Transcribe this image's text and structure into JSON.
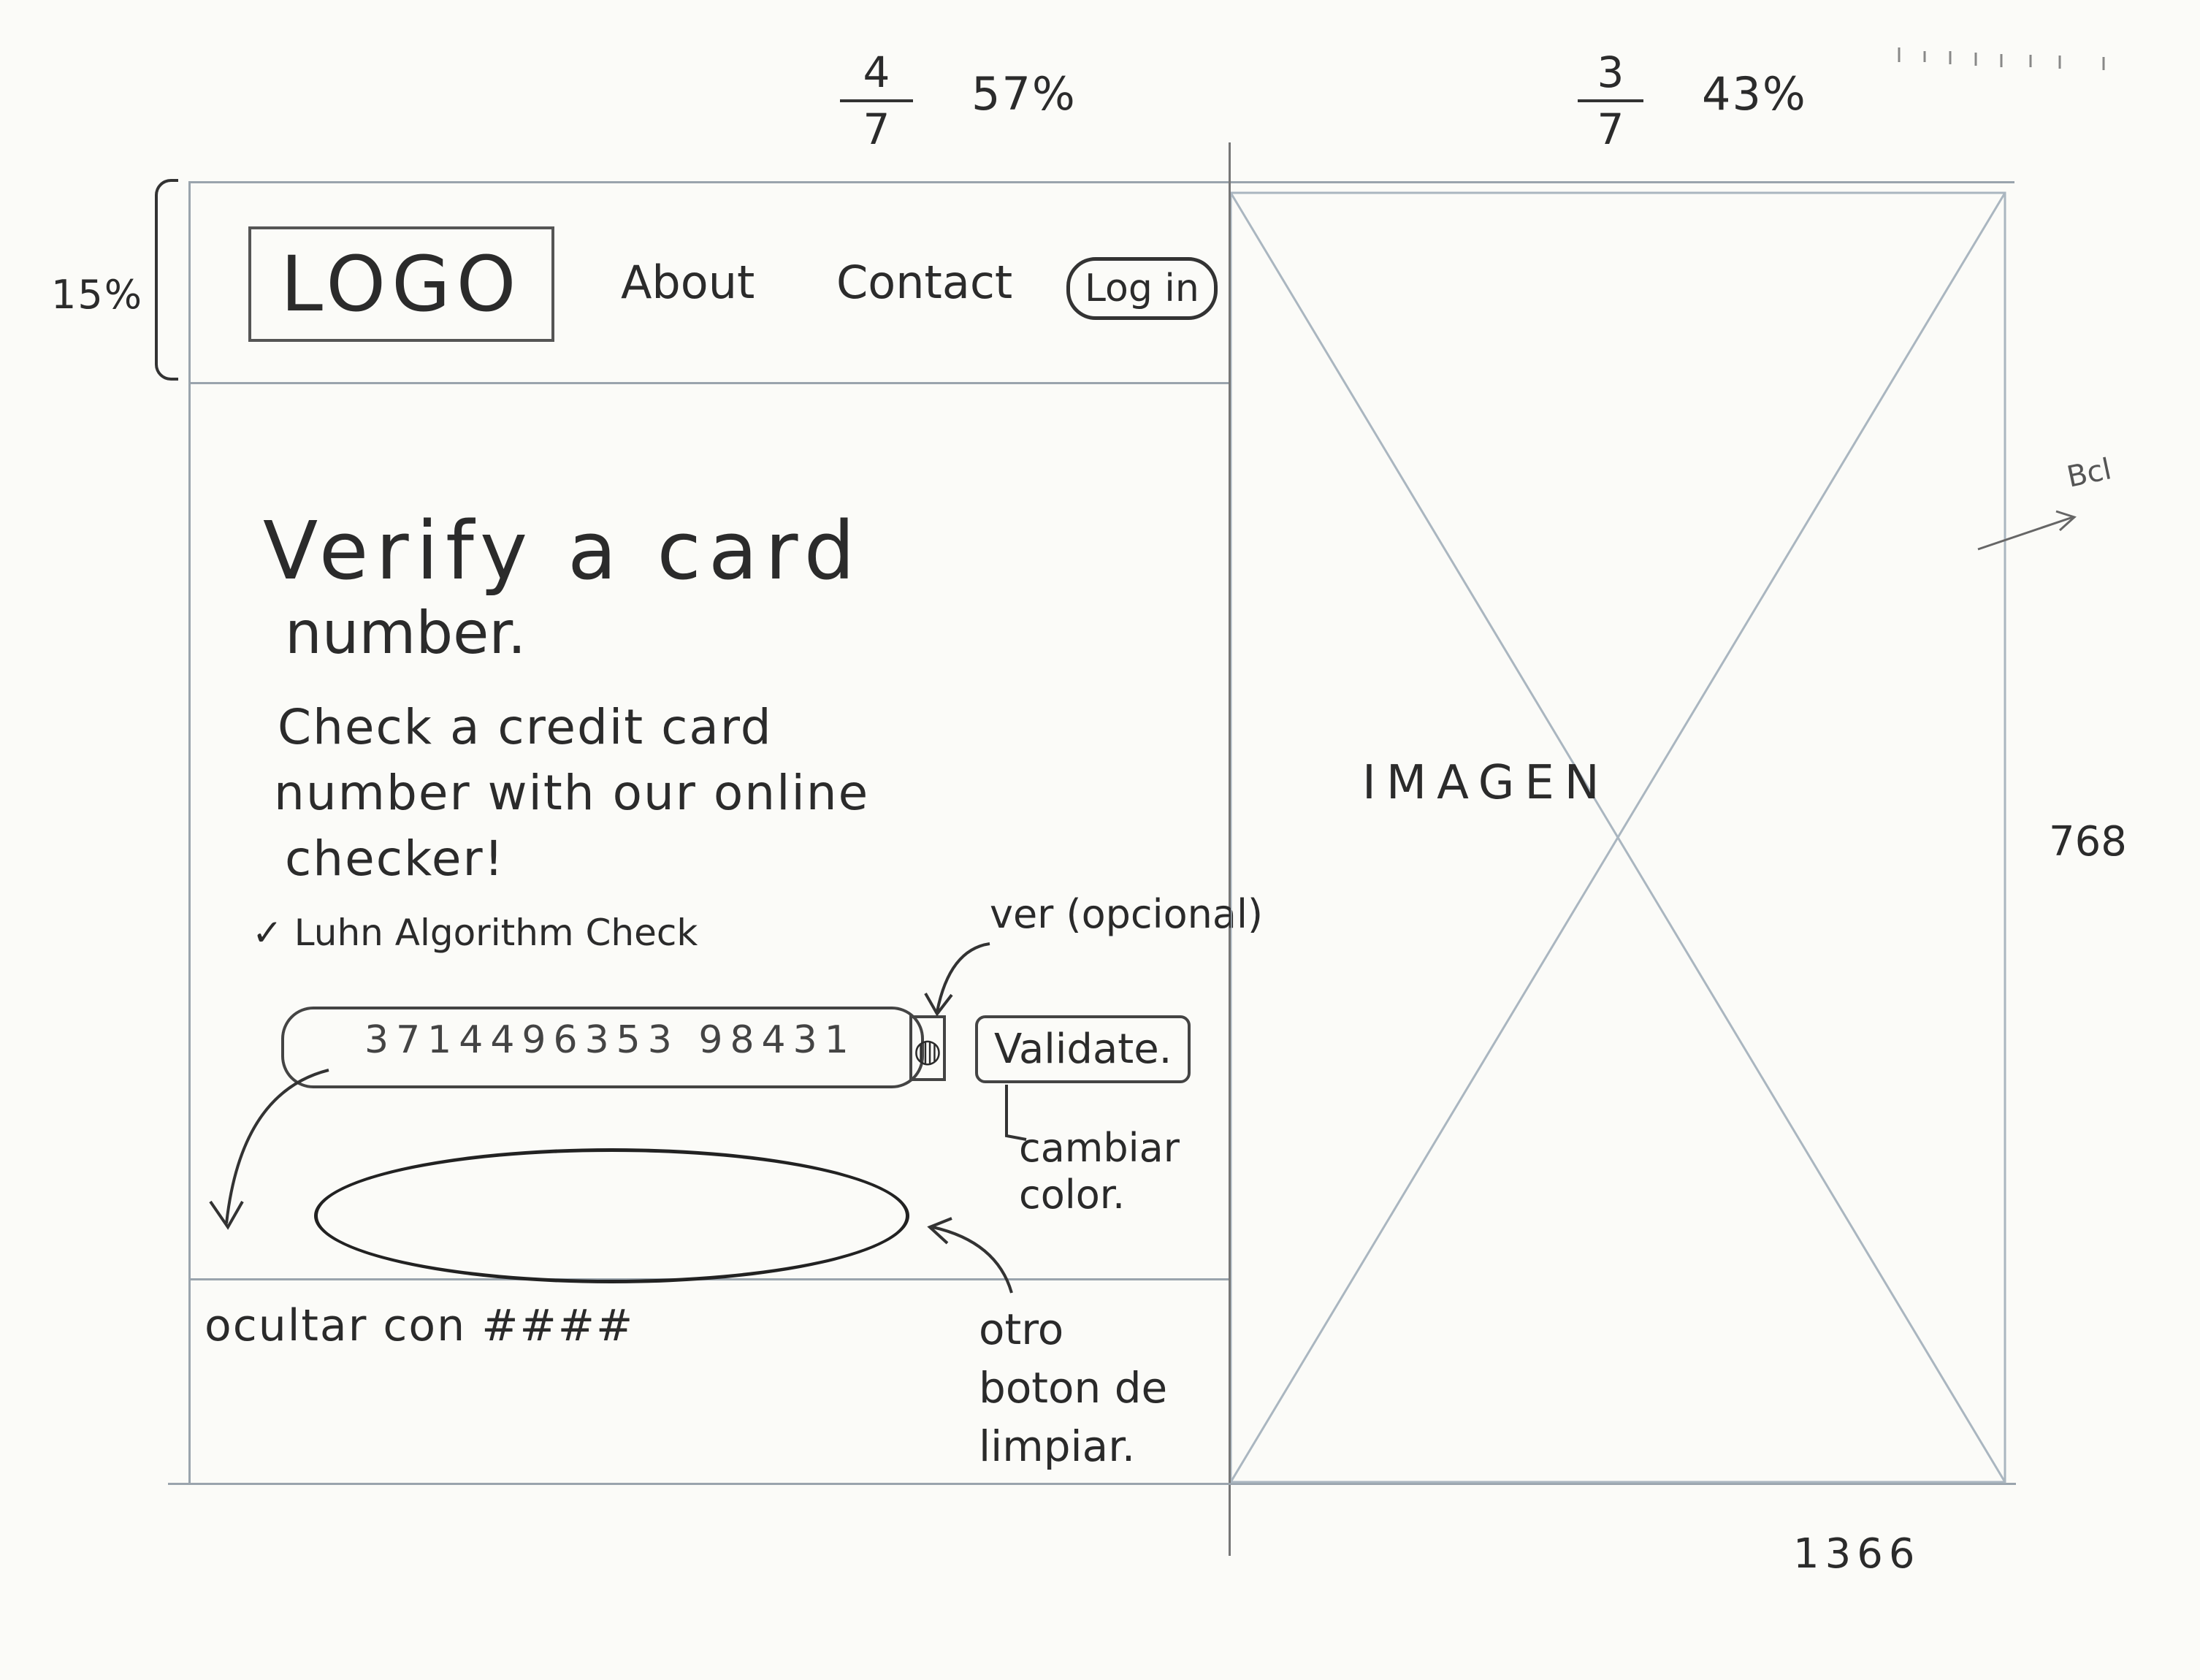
{
  "annotations": {
    "left_fraction": {
      "num": "4",
      "den": "7"
    },
    "left_percent": "57%",
    "right_fraction": {
      "num": "3",
      "den": "7"
    },
    "right_percent": "43%",
    "header_percent": "15%",
    "height_label": "768",
    "width_label": "1366",
    "side_note": "Bcl",
    "eye_note": "ver (opcional)",
    "validate_note": "cambiar color.",
    "clear_note": "otro boton de limpiar.",
    "mask_note": "ocultar con ####"
  },
  "header": {
    "logo": "LOGO",
    "nav": [
      "About",
      "Contact"
    ],
    "login_label": "Log in"
  },
  "hero": {
    "title_line1": "Verify a card",
    "title_line2": "number.",
    "subtitle_line1": "Check a credit card",
    "subtitle_line2": "number with our online",
    "subtitle_line3": "checker!",
    "check_item": "Luhn Algorithm Check"
  },
  "form": {
    "card_value": "3714496353 98431",
    "eye_icon": "eye-icon",
    "validate_label": "Validate."
  },
  "image_panel": {
    "label": "IMAGEN"
  }
}
